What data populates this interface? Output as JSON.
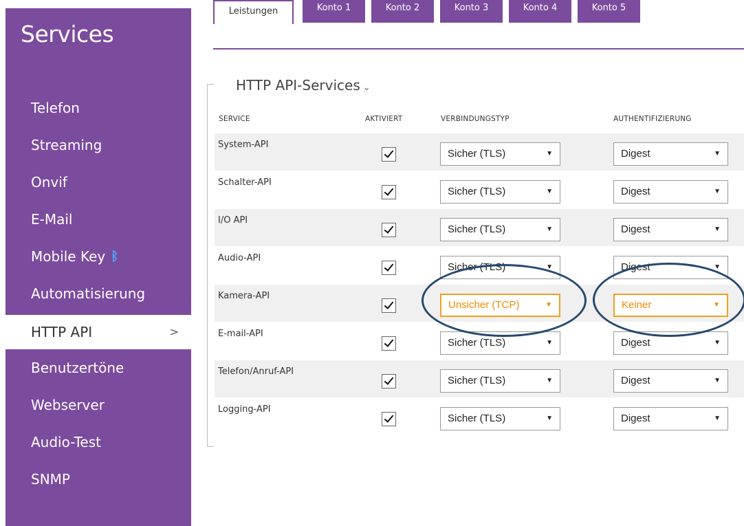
{
  "sidebar": {
    "title": "Services",
    "items": [
      {
        "label": "Telefon"
      },
      {
        "label": "Streaming"
      },
      {
        "label": "Onvif"
      },
      {
        "label": "E-Mail"
      },
      {
        "label": "Mobile Key",
        "icon": "bluetooth-icon"
      },
      {
        "label": "Automatisierung"
      },
      {
        "label": "HTTP API",
        "active": true
      },
      {
        "label": "Benutzertöne"
      },
      {
        "label": "Webserver"
      },
      {
        "label": "Audio-Test"
      },
      {
        "label": "SNMP"
      }
    ],
    "active_chevron": ">",
    "bluetooth_glyph": "ᛒ"
  },
  "tabs": [
    "Leistungen",
    "Konto 1",
    "Konto 2",
    "Konto 3",
    "Konto 4",
    "Konto 5"
  ],
  "section": {
    "title": "HTTP API-Services",
    "caret": "⌄"
  },
  "table": {
    "headers": {
      "service": "SERVICE",
      "enabled": "AKTIVIERT",
      "connection": "VERBINDUNGSTYP",
      "auth": "AUTHENTIFIZIERUNG"
    },
    "rows": [
      {
        "service": "System-API",
        "enabled": true,
        "connection": "Sicher (TLS)",
        "auth": "Digest"
      },
      {
        "service": "Schalter-API",
        "enabled": true,
        "connection": "Sicher (TLS)",
        "auth": "Digest"
      },
      {
        "service": "I/O API",
        "enabled": true,
        "connection": "Sicher (TLS)",
        "auth": "Digest"
      },
      {
        "service": "Audio-API",
        "enabled": true,
        "connection": "Sicher (TLS)",
        "auth": "Digest"
      },
      {
        "service": "Kamera-API",
        "enabled": true,
        "connection": "Unsicher (TCP)",
        "auth": "Keiner",
        "warning": true
      },
      {
        "service": "E-mail-API",
        "enabled": true,
        "connection": "Sicher (TLS)",
        "auth": "Digest"
      },
      {
        "service": "Telefon/Anruf-API",
        "enabled": true,
        "connection": "Sicher (TLS)",
        "auth": "Digest"
      },
      {
        "service": "Logging-API",
        "enabled": true,
        "connection": "Sicher (TLS)",
        "auth": "Digest"
      }
    ],
    "dropdown_arrow": "▼"
  },
  "colors": {
    "brand_purple": "#7b4b9e",
    "warning_orange": "#f08a00",
    "highlight_ring": "#25486e"
  }
}
